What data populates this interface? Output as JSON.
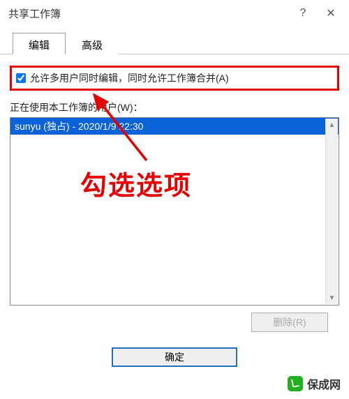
{
  "titlebar": {
    "title": "共享工作簿"
  },
  "tabs": {
    "editing": "编辑",
    "advanced": "高级"
  },
  "editing_panel": {
    "allow_multi_user_label": "允许多用户同时编辑，同时允许工作簿合并(A)",
    "allow_multi_user_checked": true,
    "users_label": "正在使用本工作簿的用户(W)：",
    "users": [
      "sunyu (独占) - 2020/1/9 22:30"
    ]
  },
  "buttons": {
    "remove": "删除(R)",
    "ok": "确定"
  },
  "annotation": {
    "callout_text": "勾选选项"
  },
  "watermark": {
    "text": "保成网"
  },
  "colors": {
    "highlight_red": "#e60000",
    "selection_blue": "#0a61d8",
    "primary_border": "#2070c0",
    "logo_green": "#20b020"
  }
}
